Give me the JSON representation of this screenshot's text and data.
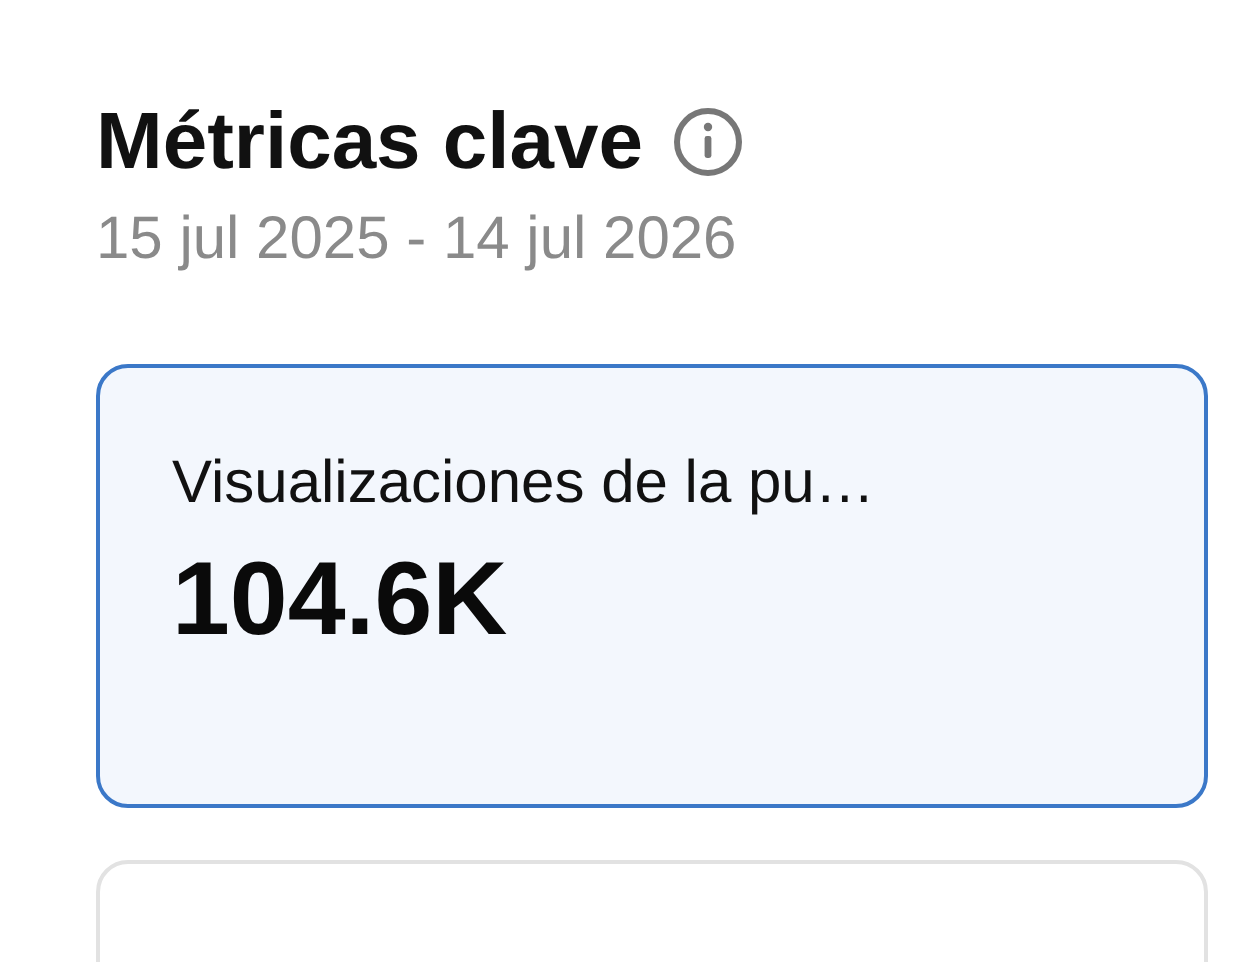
{
  "header": {
    "title": "Métricas clave",
    "date_range": "15 jul 2025 - 14 jul 2026"
  },
  "cards": [
    {
      "label": "Visualizaciones de la pu…",
      "value": "104.6K",
      "selected": true
    }
  ]
}
